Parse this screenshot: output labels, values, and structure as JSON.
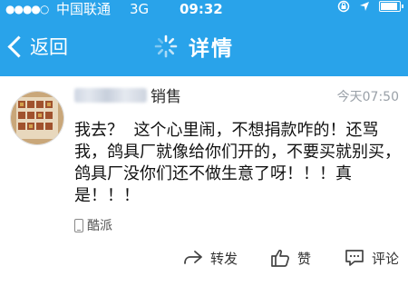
{
  "status_bar": {
    "signal": "●●●●○",
    "carrier": "中国联通",
    "network": "3G",
    "time": "09:32",
    "battery_level_percent": 80
  },
  "nav": {
    "back_label": "返回",
    "title": "详情"
  },
  "post": {
    "author_suffix": "销售",
    "time": "今天07:50",
    "text": "我去？  这个心里闹，不想捐款咋的！还骂我，鸽具厂就像给你们开的，不要买就别买，鸽具厂没你们还不做生意了呀！！！真是！！！",
    "source": "酷派"
  },
  "actions": {
    "forward_label": "转发",
    "like_label": "赞",
    "comment_label": "评论"
  },
  "colors": {
    "header_background": "#29a3ea",
    "header_text": "#ffffff",
    "time_text": "#9aa1a8"
  },
  "icons": [
    "back-chevron-icon",
    "loading-spinner-icon",
    "lock-rotation-icon",
    "location-arrow-icon",
    "battery-icon",
    "phone-icon",
    "forward-icon",
    "thumb-up-icon",
    "comment-icon"
  ]
}
